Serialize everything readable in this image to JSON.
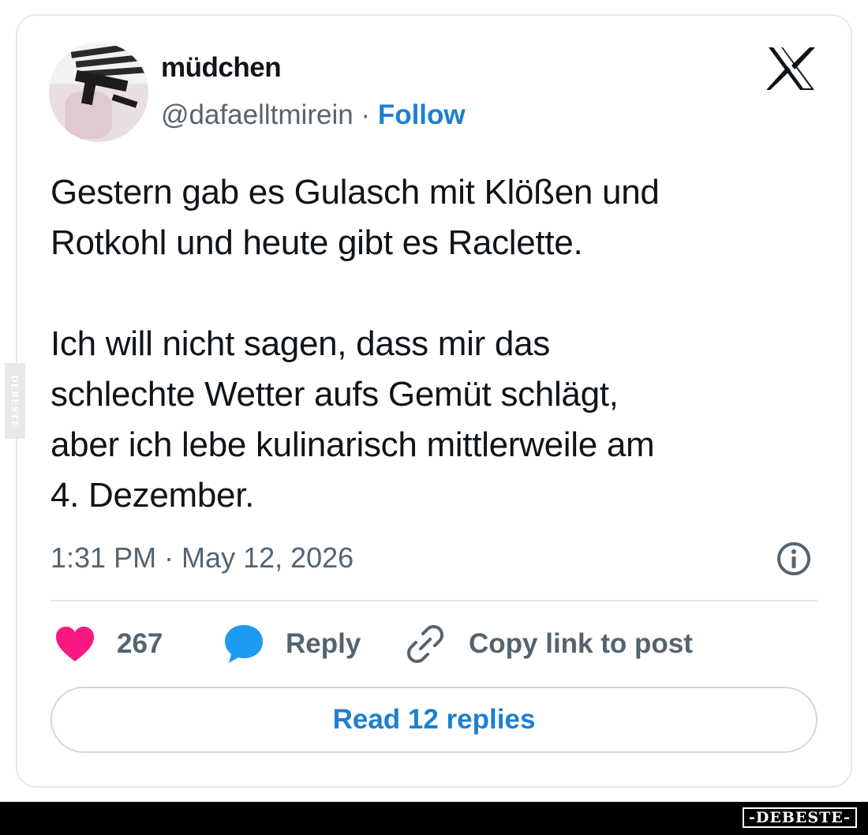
{
  "post": {
    "display_name": "müdchen",
    "handle": "@dafaelltmirein",
    "separator": "·",
    "follow_label": "Follow",
    "text": "Gestern gab es Gulasch mit Klößen und\nRotkohl und heute gibt es Raclette.\n\nIch will nicht sagen, dass mir das\nschlechte Wetter aufs Gemüt schlägt,\naber ich lebe kulinarisch mittlerweile am\n4. Dezember.",
    "timestamp": "1:31 PM · May 12, 2026"
  },
  "actions": {
    "like_count": "267",
    "reply_label": "Reply",
    "copy_link_label": "Copy link to post"
  },
  "read_replies_label": "Read 12 replies",
  "icons": {
    "brand": "x-logo-icon",
    "info": "info-icon",
    "like": "heart-icon",
    "reply": "speech-bubble-icon",
    "copy": "link-icon"
  },
  "colors": {
    "link": "#1d7fd1",
    "heart": "#f91880",
    "reply": "#1d9bf0",
    "muted": "#536471"
  },
  "watermark": {
    "side_text": "DEBESTE",
    "bottom_logo": "-DEBESTE-"
  }
}
